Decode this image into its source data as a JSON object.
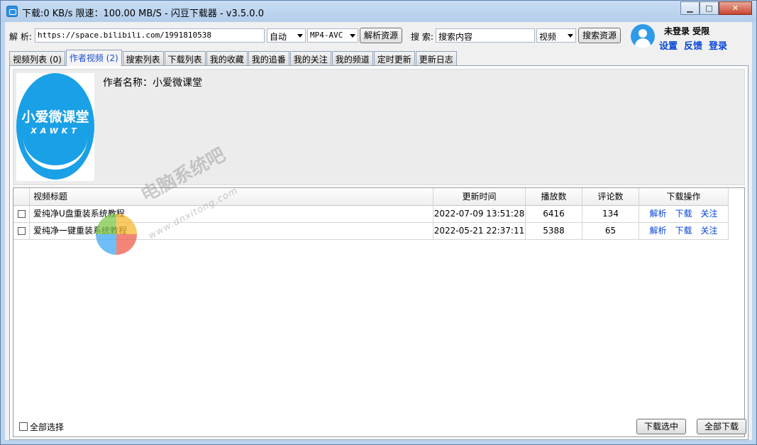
{
  "window": {
    "title": "下载:0 KB/s  限速：100.00 MB/S  - 闪豆下载器 - v3.5.0.0",
    "minimize": "▁",
    "maximize": "□",
    "close": "✕"
  },
  "toolbar": {
    "parse_label": "解 析:",
    "parse_value": "https://space.bilibili.com/1991810538",
    "quality_select": "自动",
    "format_select": "MP4-AVC",
    "parse_button": "解析资源",
    "search_label": "搜 索:",
    "search_placeholder": "搜索内容",
    "search_type_select": "视频",
    "search_button": "搜索资源"
  },
  "user": {
    "status": "未登录  受限",
    "settings": "设置",
    "feedback": "反馈",
    "login": "登录"
  },
  "tabs": [
    {
      "label": "视频列表 (0)"
    },
    {
      "label": "作者视频 (2)",
      "active": true
    },
    {
      "label": "搜索列表"
    },
    {
      "label": "下载列表"
    },
    {
      "label": "我的收藏"
    },
    {
      "label": "我的追番"
    },
    {
      "label": "我的关注"
    },
    {
      "label": "我的频道"
    },
    {
      "label": "定时更新"
    },
    {
      "label": "更新日志"
    }
  ],
  "author": {
    "name_label": "作者名称：小爱微课堂",
    "logo_cn": "小爱微课堂",
    "logo_en": "XAWKT"
  },
  "table": {
    "columns": [
      "视频标题",
      "更新时间",
      "播放数",
      "评论数",
      "下载操作"
    ],
    "rows": [
      {
        "title": "爱纯净U盘重装系统教程",
        "time": "2022-07-09 13:51:28",
        "plays": "6416",
        "comments": "134"
      },
      {
        "title": "爱纯净一键重装系统教程",
        "time": "2022-05-21 22:37:11",
        "plays": "5388",
        "comments": "65"
      }
    ],
    "actions": [
      "解析",
      "下载",
      "关注"
    ]
  },
  "footer": {
    "select_all": "全部选择",
    "download_selected": "下载选中",
    "download_all": "全部下载"
  },
  "watermark": {
    "text": "电脑系统吧",
    "url": "www.dnxitong.com"
  }
}
